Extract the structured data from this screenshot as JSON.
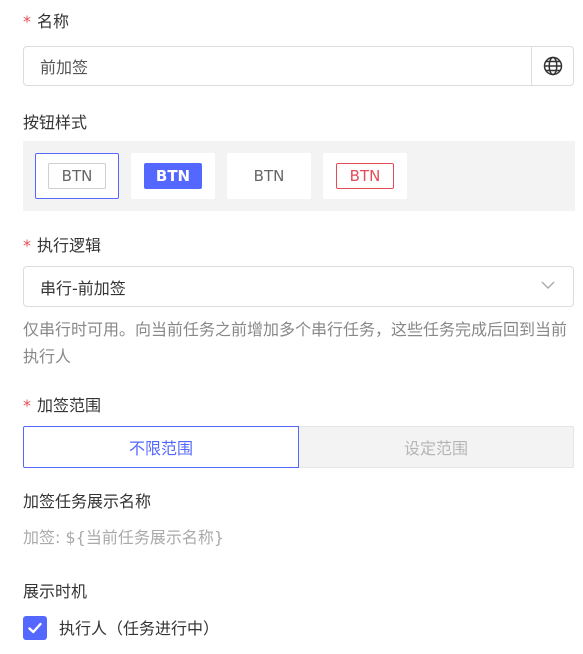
{
  "name_field": {
    "required_mark": "*",
    "label": "名称",
    "value": "前加签",
    "globe_icon": "globe-icon"
  },
  "button_style": {
    "label": "按钮样式",
    "options": [
      {
        "text": "BTN",
        "variant": "outline",
        "selected": true
      },
      {
        "text": "BTN",
        "variant": "primary",
        "selected": false
      },
      {
        "text": "BTN",
        "variant": "text",
        "selected": false
      },
      {
        "text": "BTN",
        "variant": "danger-outline",
        "selected": false
      }
    ]
  },
  "execution_logic": {
    "required_mark": "*",
    "label": "执行逻辑",
    "value": "串行-前加签",
    "chevron_icon": "chevron-down-icon",
    "help": "仅串行时可用。向当前任务之前增加多个串行任务，这些任务完成后回到当前执行人"
  },
  "scope": {
    "required_mark": "*",
    "label": "加签范围",
    "options": [
      "不限范围",
      "设定范围"
    ],
    "selected": 0
  },
  "display_name": {
    "label": "加签任务展示名称",
    "placeholder": "加签: ${当前任务展示名称}"
  },
  "display_timing": {
    "label": "展示时机",
    "checkbox_label": "执行人（任务进行中）",
    "checked": true
  },
  "colors": {
    "accent": "#5468ff",
    "required": "#e34d59",
    "muted_bg": "#f3f3f3"
  }
}
